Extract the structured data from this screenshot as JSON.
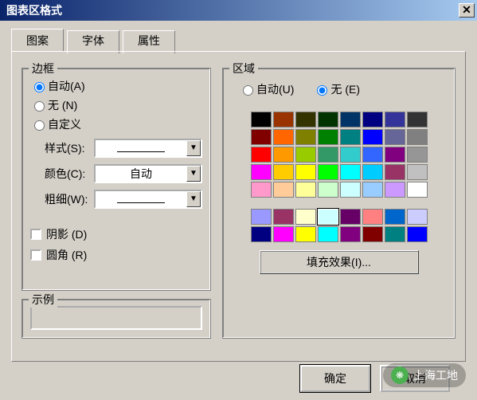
{
  "title": "图表区格式",
  "tabs": {
    "pattern": "图案",
    "font": "字体",
    "attr": "属性"
  },
  "border": {
    "legend": "边框",
    "auto": "自动(A)",
    "none": "无 (N)",
    "custom": "自定义",
    "style_lbl": "样式(S):",
    "color_lbl": "颜色(C):",
    "weight_lbl": "粗细(W):",
    "color_val": "自动",
    "shadow": "阴影 (D)",
    "round": "圆角 (R)"
  },
  "area": {
    "legend": "区域",
    "auto": "自动(U)",
    "none": "无 (E)",
    "fill_btn": "填充效果(I)..."
  },
  "example": {
    "legend": "示例"
  },
  "buttons": {
    "ok": "确定",
    "cancel": "取消"
  },
  "palette_main": [
    "#000000",
    "#993300",
    "#333300",
    "#003300",
    "#003366",
    "#000080",
    "#333399",
    "#333333",
    "#800000",
    "#ff6600",
    "#808000",
    "#008000",
    "#008080",
    "#0000ff",
    "#666699",
    "#808080",
    "#ff0000",
    "#ff9900",
    "#99cc00",
    "#339966",
    "#33cccc",
    "#3366ff",
    "#800080",
    "#969696",
    "#ff00ff",
    "#ffcc00",
    "#ffff00",
    "#00ff00",
    "#00ffff",
    "#00ccff",
    "#993366",
    "#c0c0c0",
    "#ff99cc",
    "#ffcc99",
    "#ffff99",
    "#ccffcc",
    "#ccffff",
    "#99ccff",
    "#cc99ff",
    "#ffffff"
  ],
  "palette_extra": [
    "#9999ff",
    "#993366",
    "#ffffcc",
    "#ccffff",
    "#660066",
    "#ff8080",
    "#0066cc",
    "#ccccff",
    "#000080",
    "#ff00ff",
    "#ffff00",
    "#00ffff",
    "#800080",
    "#800000",
    "#008080",
    "#0000ff"
  ],
  "selected_swatch": "#ccffff",
  "watermark": "上海工地"
}
